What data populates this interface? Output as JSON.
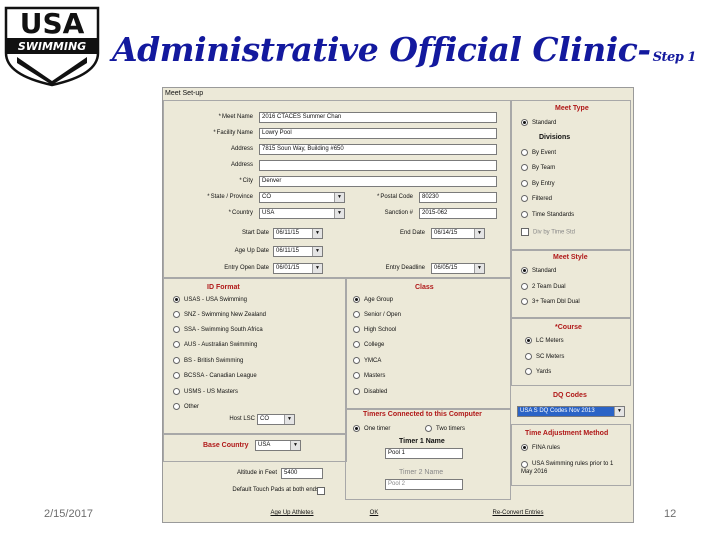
{
  "logo": {
    "top_text": "USA",
    "band_text": "SWIMMING",
    "icon": "usa-swimming-logo"
  },
  "slide": {
    "title": "Administrative Official Clinic-",
    "step": "Step 1",
    "date": "2/15/2017",
    "page": "12"
  },
  "dialog": {
    "title": "Meet Set-up",
    "fields": {
      "meet_name": {
        "label": "Meet Name",
        "value": "2016 CTACES Summer Chan"
      },
      "facility_name": {
        "label": "Facility Name",
        "value": "Lowry Pool"
      },
      "address": {
        "label": "Address",
        "value": "7815 Soun Way, Building #650"
      },
      "address2": {
        "label": "Address",
        "value": ""
      },
      "city": {
        "label": "City",
        "value": "Denver"
      },
      "state": {
        "label": "State / Province",
        "value": "CO"
      },
      "postal_code": {
        "label": "Postal Code",
        "value": "80230"
      },
      "country": {
        "label": "Country",
        "value": "USA"
      },
      "sanction": {
        "label": "Sanction #",
        "value": "2015-062"
      },
      "start_date": {
        "label": "Start Date",
        "value": "06/11/15"
      },
      "end_date": {
        "label": "End Date",
        "value": "06/14/15"
      },
      "age_up_date": {
        "label": "Age Up Date",
        "value": "06/11/15"
      },
      "entry_open_date": {
        "label": "Entry Open Date",
        "value": "06/01/15"
      },
      "entry_deadline": {
        "label": "Entry Deadline",
        "value": "06/05/15"
      }
    },
    "meet_type": {
      "title": "Meet Type",
      "standard": "Standard",
      "divisions_title": "Divisions",
      "divisions": [
        "By Event",
        "By Team",
        "By Entry",
        "Filtered",
        "Time Standards"
      ],
      "div_by_time_std": "Div by Time Std"
    },
    "meet_style": {
      "title": "Meet Style",
      "options": [
        "Standard",
        "2 Team Dual",
        "3+ Team Dbl Dual"
      ]
    },
    "course": {
      "title": "Course",
      "options": [
        "LC Meters",
        "SC Meters",
        "Yards"
      ]
    },
    "dq_codes": {
      "title": "DQ Codes",
      "value": "USA S DQ Codes Nov 2013"
    },
    "time_adjustment": {
      "title": "Time Adjustment Method",
      "options": [
        "FINA rules",
        "USA Swimming rules prior to 1 May 2016"
      ]
    },
    "id_format": {
      "title": "ID Format",
      "options": [
        "USAS - USA Swimming",
        "SNZ - Swimming New Zealand",
        "SSA - Swimming South Africa",
        "AUS - Australian Swimming",
        "BS - British Swimming",
        "BCSSA - Canadian League",
        "USMS - US Masters",
        "Other"
      ],
      "host_lsc_label": "Host LSC",
      "host_lsc_value": "CO"
    },
    "class": {
      "title": "Class",
      "options": [
        "Age Group",
        "Senior / Open",
        "High School",
        "College",
        "YMCA",
        "Masters",
        "Disabled"
      ]
    },
    "base_country": {
      "title": "Base Country",
      "value": "USA"
    },
    "altitude": {
      "label": "Altitude in Feet",
      "value": "5400"
    },
    "default_touch_pads": {
      "label": "Default Touch Pads at both ends"
    },
    "timers": {
      "title": "Timers Connected to this Computer",
      "options": [
        "One timer",
        "Two timers"
      ],
      "timer1_label": "Timer 1 Name",
      "timer1_value": "Pool 1",
      "timer2_label": "Timer 2 Name",
      "timer2_value": "Pool 2"
    },
    "buttons": {
      "age_up": "Age Up Athletes",
      "ok": "OK",
      "re_convert": "Re-Convert Entries"
    }
  }
}
